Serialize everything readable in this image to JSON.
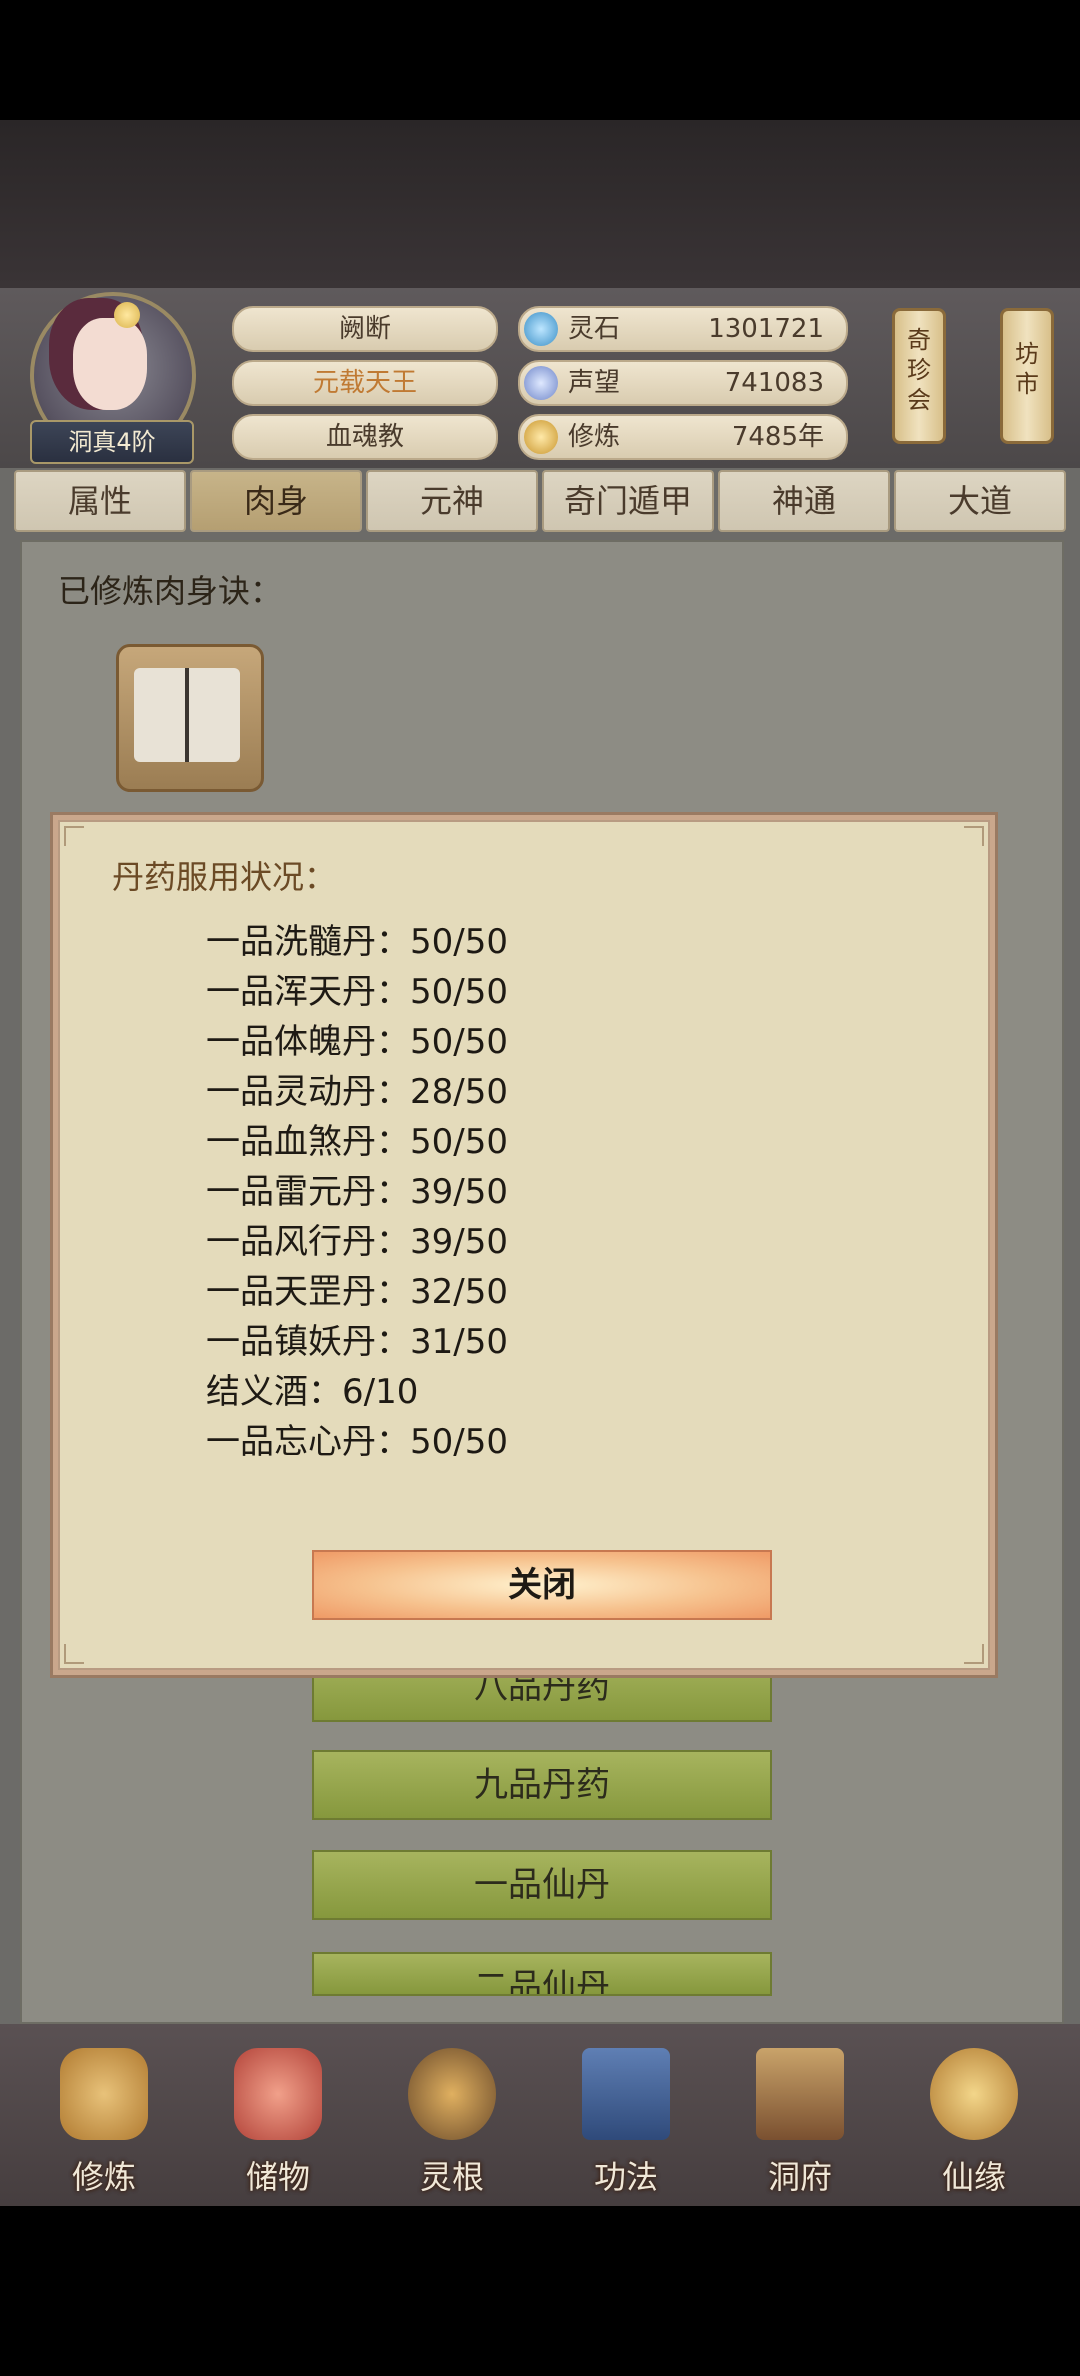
{
  "header": {
    "rank": "洞真4阶",
    "names": [
      "阙断",
      "元载天王",
      "血魂教"
    ],
    "resources": [
      {
        "label": "灵石",
        "value": "1301721",
        "icon": "spirit-stone-icon"
      },
      {
        "label": "声望",
        "value": "741083",
        "icon": "reputation-icon"
      },
      {
        "label": "修炼",
        "value": "7485年",
        "icon": "cultivation-icon"
      }
    ],
    "scrolls": [
      "奇\n珍\n会",
      "坊\n市"
    ]
  },
  "tabs": [
    "属性",
    "肉身",
    "元神",
    "奇门遁甲",
    "神通",
    "大道"
  ],
  "active_tab": "肉身",
  "main": {
    "section_title": "已修炼肉身诀：",
    "list_buttons": [
      "八品丹药",
      "九品丹药",
      "一品仙丹",
      "二品仙丹"
    ]
  },
  "modal": {
    "title": "丹药服用状况：",
    "rows": [
      "一品洗髓丹：50/50",
      "一品浑天丹：50/50",
      "一品体魄丹：50/50",
      "一品灵动丹：28/50",
      "一品血煞丹：50/50",
      "一品雷元丹：39/50",
      "一品风行丹：39/50",
      "一品天罡丹：32/50",
      "一品镇妖丹：31/50",
      "结义酒：6/10",
      "一品忘心丹：50/50"
    ],
    "close_label": "关闭"
  },
  "nav": [
    "修炼",
    "储物",
    "灵根",
    "功法",
    "洞府",
    "仙缘"
  ],
  "colors": {
    "accent": "#c07a33",
    "modal_bg": "#e4dbbb",
    "close_button": "#f6c28e",
    "list_button": "#a7b45e"
  }
}
